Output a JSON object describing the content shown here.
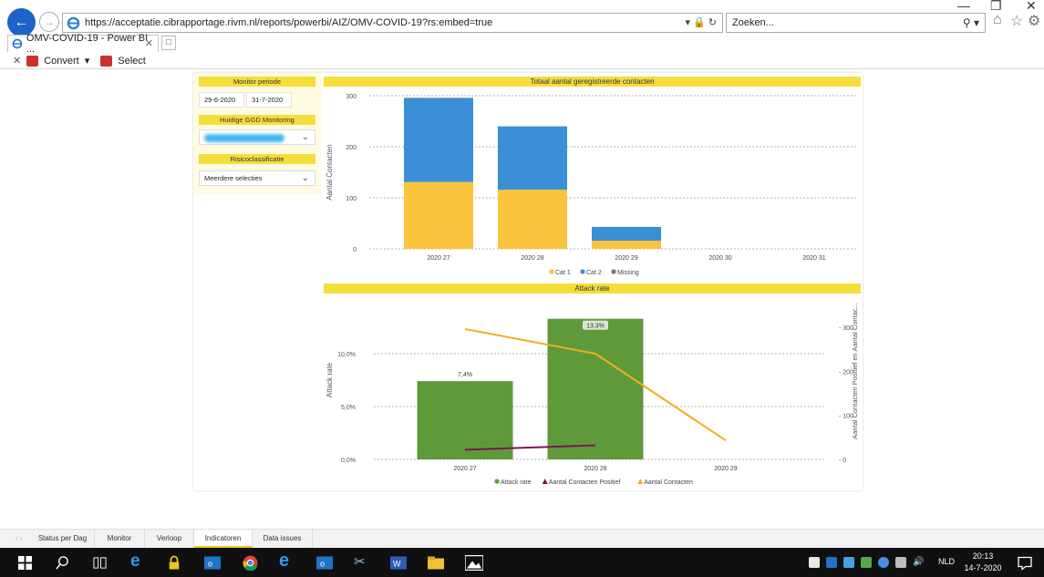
{
  "browser": {
    "url": "https://acceptatie.cibrapportage.rivm.nl/reports/powerbi/AIZ/OMV-COVID-19?rs:embed=true",
    "search_placeholder": "Zoeken...",
    "tab_title": "OMV-COVID-19 - Power BI ...",
    "commands": {
      "convert": "Convert",
      "select": "Select"
    }
  },
  "filters": {
    "monitor_periode_label": "Monitor periode",
    "date_start": "29-6-2020",
    "date_end": "31-7-2020",
    "ggd_label": "Huidige GGD Monitoring",
    "risk_label": "Risicoclassificatie",
    "risk_value": "Meerdere selecties"
  },
  "chart1": {
    "title": "Totaal aantal geregistreerde contacten",
    "legend": {
      "cat1": "Cat 1",
      "cat2": "Cat 2",
      "missing": "Missing"
    },
    "colors": {
      "cat1": "#fcc33c",
      "cat2": "#3a8fd6",
      "missing": "#777777"
    }
  },
  "chart2": {
    "title": "Attack rate",
    "legend": {
      "attack": "Attack rate",
      "positief": "Aantal Contacten Positief",
      "contacten": "Aantal Contacten"
    },
    "colors": {
      "attack": "#5f9a3a",
      "positief": "#7a1656",
      "contacten": "#f0ae1c"
    }
  },
  "chart_data": [
    {
      "type": "bar",
      "title": "Totaal aantal geregistreerde contacten",
      "xlabel": "",
      "ylabel": "Aantal Contacten",
      "categories": [
        "2020 27",
        "2020 28",
        "2020 29",
        "2020 30",
        "2020 31"
      ],
      "stacked": true,
      "series": [
        {
          "name": "Cat 1",
          "values": [
            131,
            116,
            16,
            0,
            0
          ]
        },
        {
          "name": "Cat 2",
          "values": [
            164,
            124,
            27,
            0,
            0
          ]
        },
        {
          "name": "Missing",
          "values": [
            1,
            0,
            0,
            0,
            0
          ]
        }
      ],
      "ylim": [
        0,
        300
      ],
      "yticks": [
        "0",
        "100",
        "200",
        "300"
      ],
      "grid": true,
      "legend_position": "bottom"
    },
    {
      "type": "bar",
      "title": "Attack rate",
      "xlabel": "",
      "ylabel": "Attack rate",
      "y2label": "Aantal Contacten Positief en Aantal Contac...",
      "categories": [
        "2020 27",
        "2020 28",
        "2020 29"
      ],
      "series": [
        {
          "name": "Attack rate",
          "type": "bar",
          "axis": "left",
          "values": [
            7.4,
            13.3,
            null
          ],
          "data_labels": [
            "7,4%",
            "13,3%",
            ""
          ]
        },
        {
          "name": "Aantal Contacten Positief",
          "type": "line",
          "axis": "right",
          "values": [
            22,
            32,
            null
          ]
        },
        {
          "name": "Aantal Contacten",
          "type": "line",
          "axis": "right",
          "values": [
            296,
            240,
            43
          ]
        }
      ],
      "ylim": [
        0,
        15
      ],
      "yticks": [
        "0,0%",
        "5,0%",
        "10,0%"
      ],
      "y2lim": [
        0,
        360
      ],
      "y2ticks": [
        "0",
        "100",
        "200",
        "300"
      ],
      "grid": true,
      "legend_position": "bottom"
    }
  ],
  "page_tabs": [
    "Status per Dag",
    "Monitor",
    "Verloop",
    "Indicatoren",
    "Data issues"
  ],
  "active_tab": "Indicatoren",
  "taskbar": {
    "language": "NLD",
    "time": "20:13",
    "date": "14-7-2020"
  }
}
